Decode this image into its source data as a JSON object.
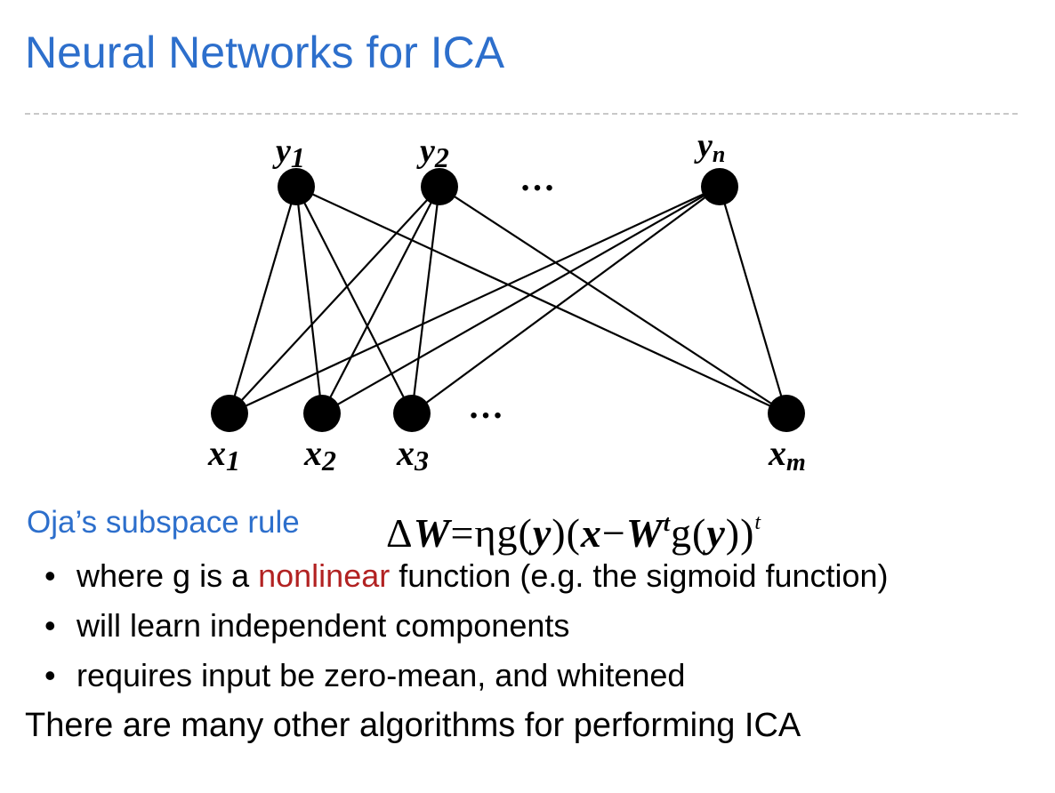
{
  "title": "Neural Networks for ICA",
  "colors": {
    "title": "#2d6fcc",
    "rule_name": "#2d6fcc",
    "highlight": "#b22222",
    "text": "#000000",
    "node": "#000000"
  },
  "diagram": {
    "output_nodes": [
      {
        "id": "y1",
        "base": "y",
        "sub": "1"
      },
      {
        "id": "y2",
        "base": "y",
        "sub": "2"
      },
      {
        "id": "yn",
        "base": "y",
        "sub": "n"
      }
    ],
    "input_nodes": [
      {
        "id": "x1",
        "base": "x",
        "sub": "1"
      },
      {
        "id": "x2",
        "base": "x",
        "sub": "2"
      },
      {
        "id": "x3",
        "base": "x",
        "sub": "3"
      },
      {
        "id": "xm",
        "base": "x",
        "sub": "m"
      }
    ],
    "output_ellipsis": "…",
    "input_ellipsis": "…",
    "edges": [
      [
        "y1",
        "x1"
      ],
      [
        "y1",
        "x2"
      ],
      [
        "y1",
        "x3"
      ],
      [
        "y1",
        "xm"
      ],
      [
        "y2",
        "x1"
      ],
      [
        "y2",
        "x2"
      ],
      [
        "y2",
        "x3"
      ],
      [
        "y2",
        "xm"
      ],
      [
        "yn",
        "x1"
      ],
      [
        "yn",
        "x2"
      ],
      [
        "yn",
        "x3"
      ],
      [
        "yn",
        "xm"
      ]
    ]
  },
  "rule": {
    "name": "Oja’s subspace rule",
    "formula": {
      "delta": "Δ",
      "W": "W",
      "equals": "=",
      "eta": "η",
      "g": "g",
      "y": "y",
      "x": "x",
      "minus": "−",
      "t": "t",
      "lparen": "(",
      "rparen": ")"
    }
  },
  "bullets": [
    {
      "before": "where g is a ",
      "highlight": "nonlinear",
      "after": " function (e.g. the sigmoid function)"
    },
    {
      "before": "will learn independent components",
      "highlight": "",
      "after": ""
    },
    {
      "before": "requires input be zero-mean, and whitened",
      "highlight": "",
      "after": ""
    }
  ],
  "bullet_symbol": "•",
  "closing": "There are many other algorithms for performing ICA"
}
